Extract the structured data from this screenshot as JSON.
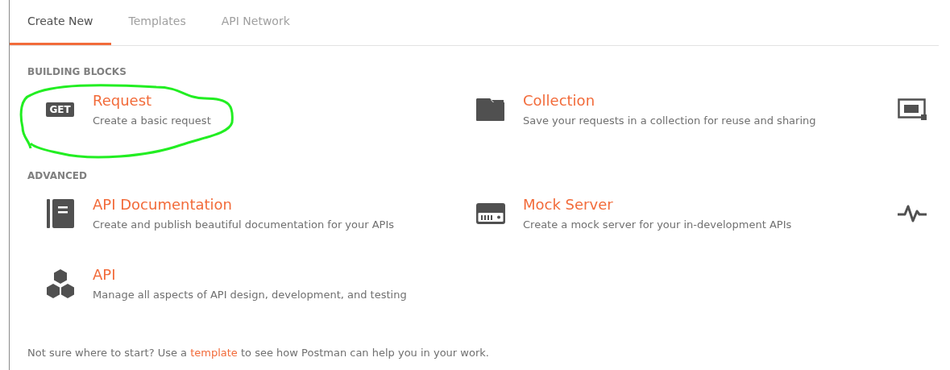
{
  "tabs": [
    {
      "label": "Create New",
      "selected": true
    },
    {
      "label": "Templates",
      "selected": false
    },
    {
      "label": "API Network",
      "selected": false
    }
  ],
  "sections": [
    {
      "heading": "BUILDING BLOCKS",
      "rows": [
        [
          {
            "kind": "badge",
            "badge": "GET",
            "title": "Request",
            "description": "Create a basic request"
          },
          {
            "kind": "folder",
            "title": "Collection",
            "description": "Save your requests in a collection for reuse and sharing"
          },
          {
            "kind": "monitor"
          }
        ]
      ]
    },
    {
      "heading": "ADVANCED",
      "rows": [
        [
          {
            "kind": "book",
            "title": "API Documentation",
            "description": "Create and publish beautiful documentation for your APIs"
          },
          {
            "kind": "server",
            "title": "Mock Server",
            "description": "Create a mock server for your in-development APIs"
          },
          {
            "kind": "pulse"
          }
        ],
        [
          {
            "kind": "hexagons",
            "title": "API",
            "description": "Manage all aspects of API design, development, and testing"
          }
        ]
      ]
    }
  ],
  "footer": {
    "before": "Not sure where to start? Use a ",
    "link": "template",
    "after": " to see how Postman can help you in your work."
  }
}
